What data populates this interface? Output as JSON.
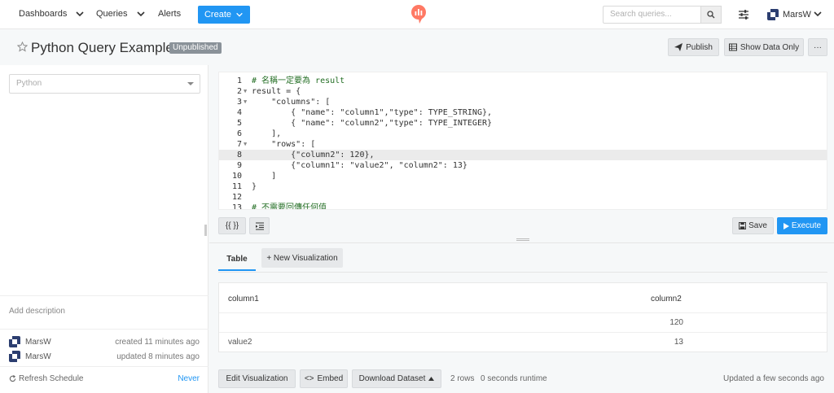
{
  "nav": {
    "dashboards": "Dashboards",
    "queries": "Queries",
    "alerts": "Alerts",
    "create": "Create",
    "search_placeholder": "Search queries...",
    "user": "MarsW"
  },
  "header": {
    "title": "Python Query Example",
    "status_badge": "Unpublished",
    "publish": "Publish",
    "show_data_only": "Show Data Only",
    "more": "···"
  },
  "sidebar": {
    "datasource": "Python",
    "add_description": "Add description",
    "created_by": "MarsW",
    "created_time": "created 11 minutes ago",
    "updated_by": "MarsW",
    "updated_time": "updated 8 minutes ago",
    "refresh_label": "Refresh Schedule",
    "refresh_value": "Never"
  },
  "editor": {
    "lines": [
      "# 名稱一定要為 result",
      "result = {",
      "    \"columns\": [",
      "        { \"name\": \"column1\",\"type\": TYPE_STRING},",
      "        { \"name\": \"column2\",\"type\": TYPE_INTEGER}",
      "    ],",
      "    \"rows\": [",
      "        {\"column2\": 120},",
      "        {\"column1\": \"value2\", \"column2\": 13}",
      "    ]",
      "}",
      "",
      "# 不需要回傳任何值"
    ],
    "active_line": 8,
    "format_label": "{{ }}",
    "save": "Save",
    "execute": "Execute"
  },
  "results": {
    "tab_table": "Table",
    "new_visualization": "+ New Visualization",
    "columns": [
      "column1",
      "column2"
    ],
    "rows": [
      [
        "",
        "120"
      ],
      [
        "value2",
        "13"
      ]
    ]
  },
  "footer": {
    "edit_visualization": "Edit Visualization",
    "embed": "Embed",
    "download_dataset": "Download Dataset",
    "rows": "2 rows",
    "runtime": "0 seconds runtime",
    "updated": "Updated a few seconds ago"
  },
  "colors": {
    "accent": "#2196f3",
    "badge": "#8a9299",
    "logo": "#ff7964"
  },
  "icons": [
    "chevron-down-icon",
    "redash-logo-icon",
    "search-icon",
    "settings-sliders-icon",
    "avatar-icon",
    "star-icon",
    "paper-plane-icon",
    "table-icon",
    "indent-icon",
    "floppy-icon",
    "play-icon",
    "refresh-icon",
    "code-icon",
    "caret-up-icon"
  ]
}
